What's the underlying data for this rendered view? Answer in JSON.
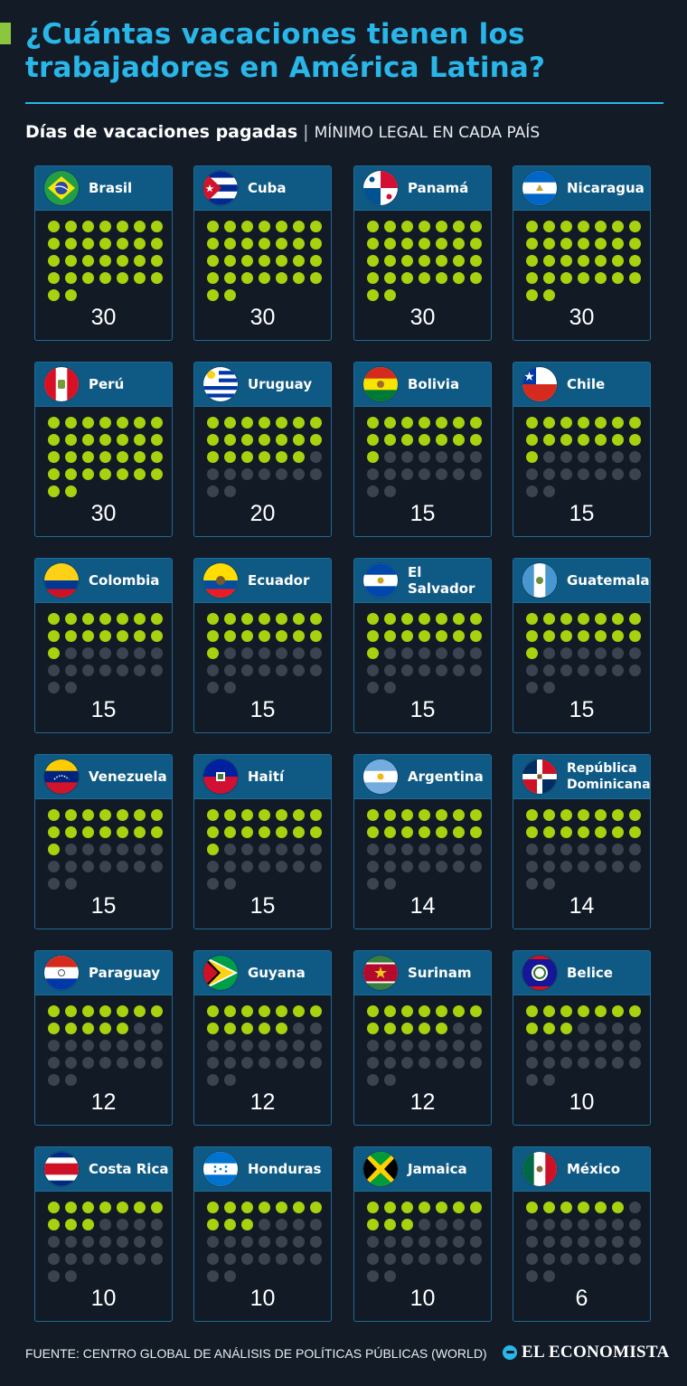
{
  "header": {
    "title_line1": "¿Cuántas vacaciones tienen los",
    "title_line2": "trabajadores en América Latina?",
    "subtitle_bold": "Días de vacaciones pagadas",
    "subtitle_separator": "|",
    "subtitle_light": "MÍNIMO LEGAL EN CADA PAÍS"
  },
  "colors": {
    "background": "#131b27",
    "title": "#29b6e8",
    "accent": "#8cc63f",
    "card_header": "#0f5a85",
    "dot_filled": "#a6d20e",
    "dot_empty": "#3b4350"
  },
  "chart_data": {
    "type": "table",
    "title": "¿Cuántas vacaciones tienen los trabajadores en América Latina?",
    "subtitle": "Días de vacaciones pagadas | MÍNIMO LEGAL EN CADA PAÍS",
    "unit": "días",
    "max_dots": 30,
    "dot_columns": 7,
    "countries": [
      {
        "name": "Brasil",
        "flag": "brazil-flag",
        "days": 30
      },
      {
        "name": "Cuba",
        "flag": "cuba-flag",
        "days": 30
      },
      {
        "name": "Panamá",
        "flag": "panama-flag",
        "days": 30
      },
      {
        "name": "Nicaragua",
        "flag": "nicaragua-flag",
        "days": 30
      },
      {
        "name": "Perú",
        "flag": "peru-flag",
        "days": 30
      },
      {
        "name": "Uruguay",
        "flag": "uruguay-flag",
        "days": 20
      },
      {
        "name": "Bolivia",
        "flag": "bolivia-flag",
        "days": 15
      },
      {
        "name": "Chile",
        "flag": "chile-flag",
        "days": 15
      },
      {
        "name": "Colombia",
        "flag": "colombia-flag",
        "days": 15
      },
      {
        "name": "Ecuador",
        "flag": "ecuador-flag",
        "days": 15
      },
      {
        "name": "El Salvador",
        "flag": "el-salvador-flag",
        "days": 15
      },
      {
        "name": "Guatemala",
        "flag": "guatemala-flag",
        "days": 15
      },
      {
        "name": "Venezuela",
        "flag": "venezuela-flag",
        "days": 15
      },
      {
        "name": "Haití",
        "flag": "haiti-flag",
        "days": 15
      },
      {
        "name": "Argentina",
        "flag": "argentina-flag",
        "days": 14
      },
      {
        "name": "República Dominicana",
        "flag": "dominican-republic-flag",
        "days": 14
      },
      {
        "name": "Paraguay",
        "flag": "paraguay-flag",
        "days": 12
      },
      {
        "name": "Guyana",
        "flag": "guyana-flag",
        "days": 12
      },
      {
        "name": "Surinam",
        "flag": "suriname-flag",
        "days": 12
      },
      {
        "name": "Belice",
        "flag": "belize-flag",
        "days": 10
      },
      {
        "name": "Costa Rica",
        "flag": "costa-rica-flag",
        "days": 10
      },
      {
        "name": "Honduras",
        "flag": "honduras-flag",
        "days": 10
      },
      {
        "name": "Jamaica",
        "flag": "jamaica-flag",
        "days": 10
      },
      {
        "name": "México",
        "flag": "mexico-flag",
        "days": 6
      }
    ]
  },
  "footer": {
    "source": "FUENTE: CENTRO GLOBAL DE ANÁLISIS DE POLÍTICAS PÚBLICAS (WORLD)",
    "brand": "EL ECONOMISTA"
  }
}
